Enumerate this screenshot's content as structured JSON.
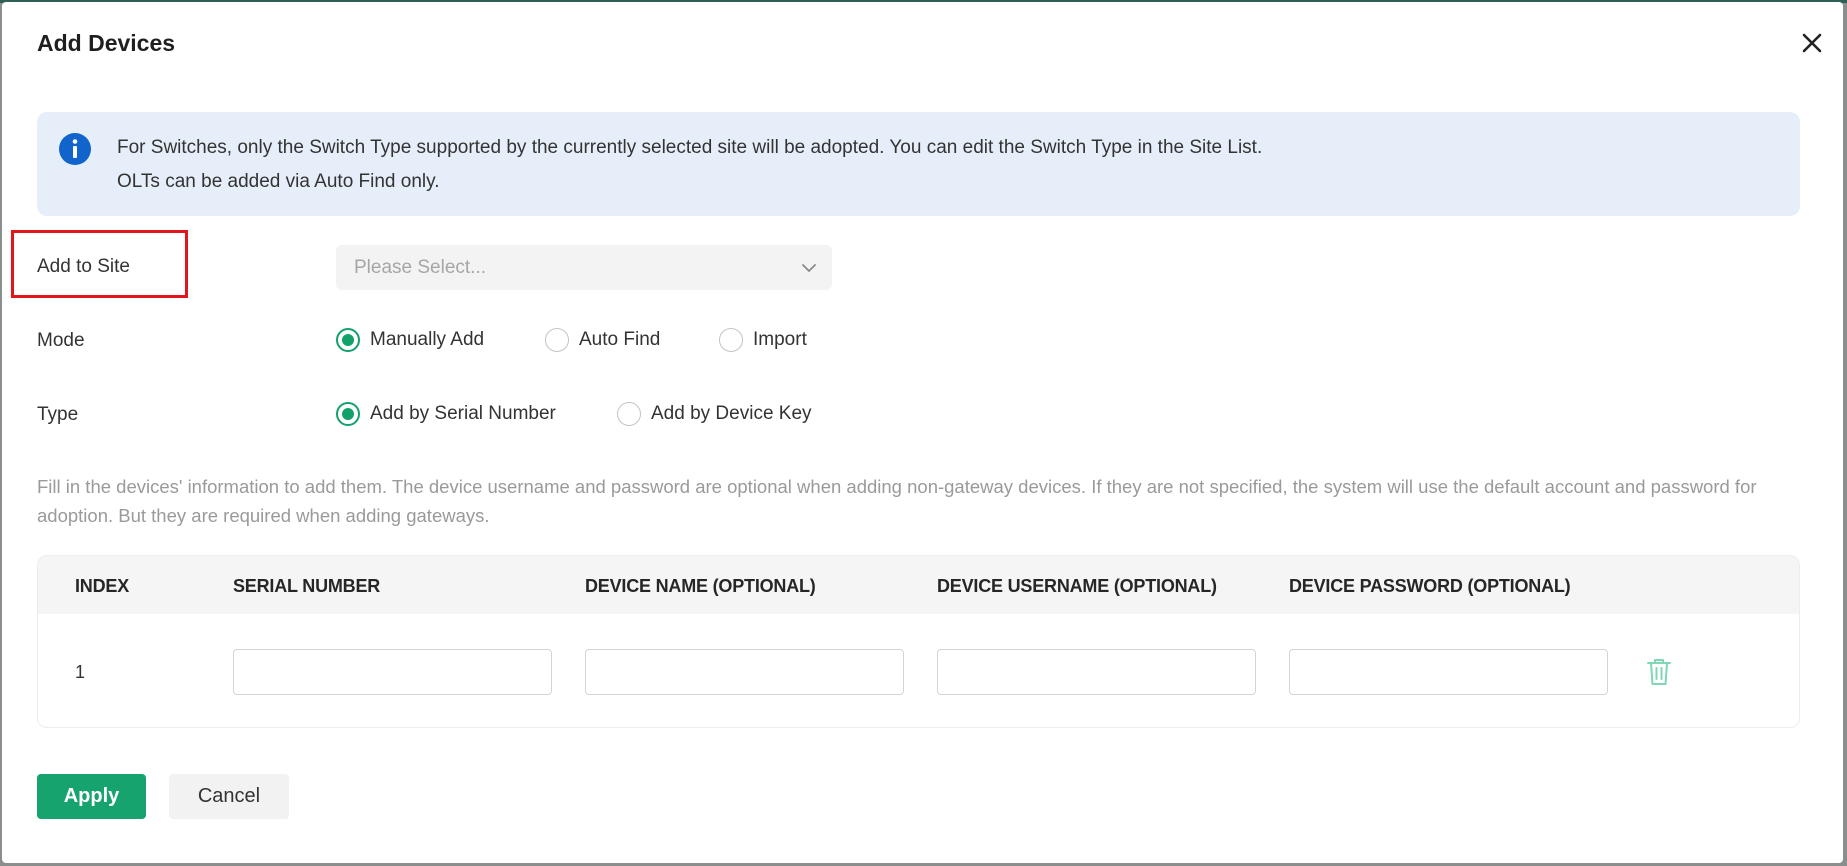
{
  "dialog": {
    "title": "Add Devices"
  },
  "info": {
    "line1": "For Switches, only the Switch Type supported by the currently selected site will be adopted. You can edit the Switch Type in the Site List.",
    "line2": "OLTs can be added via Auto Find only.",
    "accent_color": "#1064cc"
  },
  "form": {
    "site": {
      "label": "Add to Site",
      "placeholder": "Please Select..."
    },
    "mode": {
      "label": "Mode",
      "options": [
        "Manually Add",
        "Auto Find",
        "Import"
      ],
      "selected": "Manually Add"
    },
    "type": {
      "label": "Type",
      "options": [
        "Add by Serial Number",
        "Add by Device Key"
      ],
      "selected": "Add by Serial Number"
    }
  },
  "description": "Fill in the devices' information to add them. The device username and password are optional when adding non-gateway devices. If they are not specified, the system will use the default account and password for adoption. But they are required when adding gateways.",
  "table": {
    "columns": [
      "INDEX",
      "SERIAL NUMBER",
      "DEVICE NAME (OPTIONAL)",
      "DEVICE USERNAME (OPTIONAL)",
      "DEVICE PASSWORD (OPTIONAL)"
    ],
    "rows": [
      {
        "index": "1",
        "serial_number": "",
        "device_name": "",
        "device_username": "",
        "device_password": ""
      }
    ]
  },
  "buttons": {
    "apply": "Apply",
    "cancel": "Cancel"
  },
  "colors": {
    "primary": "#17a36e",
    "highlight_border": "#e0161c"
  }
}
